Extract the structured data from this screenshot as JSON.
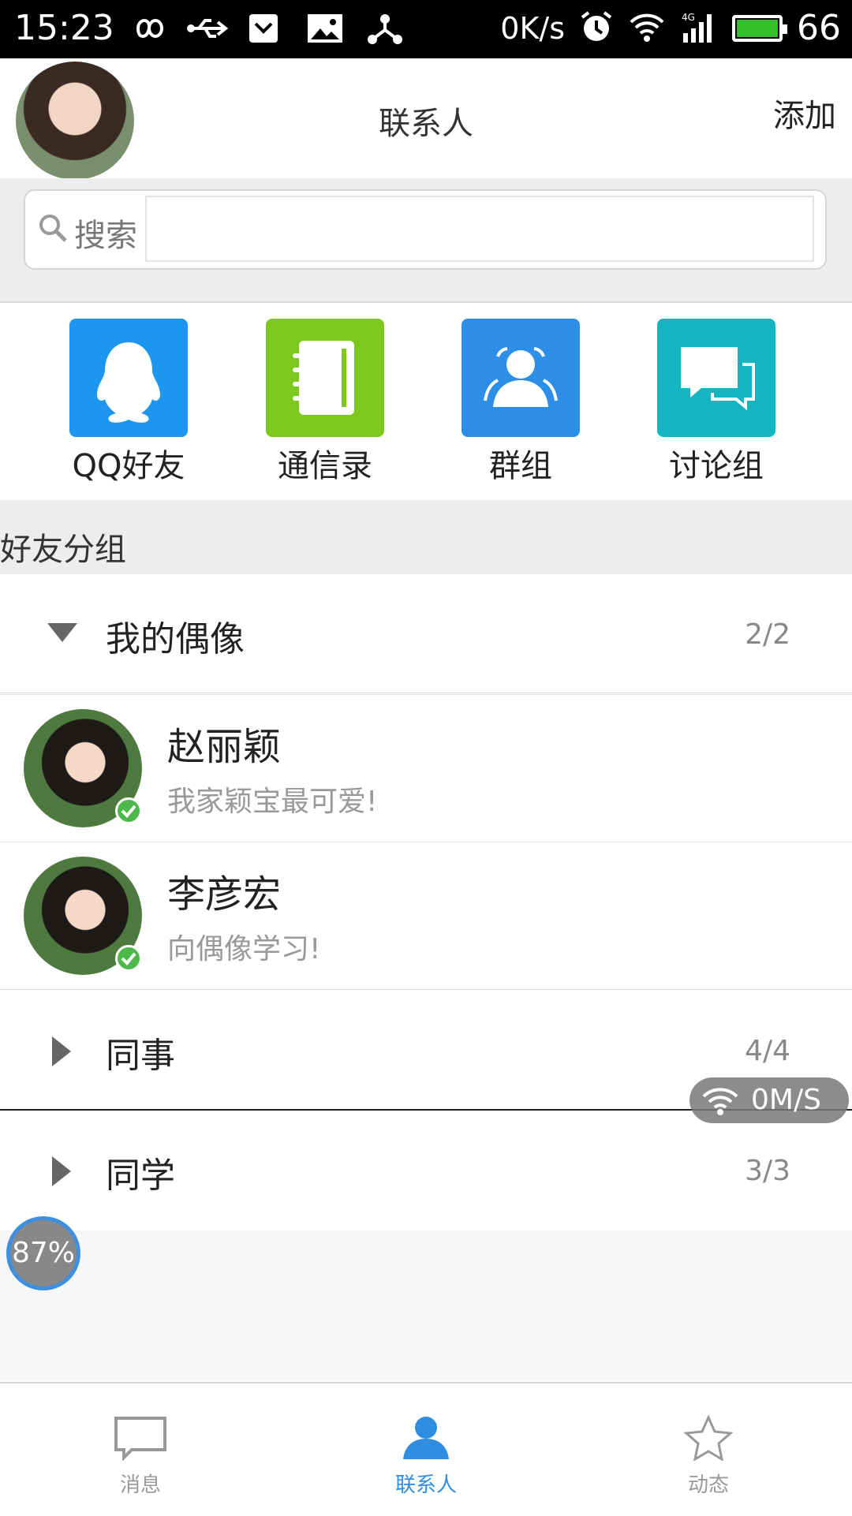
{
  "status_bar": {
    "time": "15:23",
    "net_speed": "0K/s",
    "battery": "66",
    "icons": [
      "infinity-icon",
      "usb-icon",
      "pocket-icon",
      "image-icon",
      "share-icon",
      "alarm-icon",
      "wifi-icon",
      "signal-4g-icon",
      "battery-icon"
    ]
  },
  "header": {
    "title": "联系人",
    "add_label": "添加"
  },
  "search": {
    "label": "搜索",
    "value": ""
  },
  "quick_entries": [
    {
      "label": "QQ好友",
      "icon": "qq-penguin-icon",
      "color": "#1e96f0"
    },
    {
      "label": "通信录",
      "icon": "address-book-icon",
      "color": "#7ec81e"
    },
    {
      "label": "群组",
      "icon": "group-people-icon",
      "color": "#2d8ee8"
    },
    {
      "label": "讨论组",
      "icon": "chat-bubbles-icon",
      "color": "#14b4c0"
    }
  ],
  "section_title": "好友分组",
  "groups": [
    {
      "name": "我的偶像",
      "count": "2/2",
      "expanded": true,
      "members": [
        {
          "name": "赵丽颖",
          "signature": "我家颖宝最可爱!",
          "online": true
        },
        {
          "name": "李彦宏",
          "signature": "向偶像学习!",
          "online": true
        }
      ]
    },
    {
      "name": "同事",
      "count": "4/4",
      "expanded": false
    },
    {
      "name": "同学",
      "count": "3/3",
      "expanded": false
    }
  ],
  "floating": {
    "speed": "0M/S",
    "boost": "87%"
  },
  "bottom_nav": [
    {
      "label": "消息",
      "icon": "message-icon",
      "active": false
    },
    {
      "label": "联系人",
      "icon": "contact-person-icon",
      "active": true
    },
    {
      "label": "动态",
      "icon": "star-icon",
      "active": false
    }
  ],
  "colors": {
    "accent": "#2f8ee0",
    "online": "#4cb84a",
    "nav_inactive": "#999999"
  }
}
